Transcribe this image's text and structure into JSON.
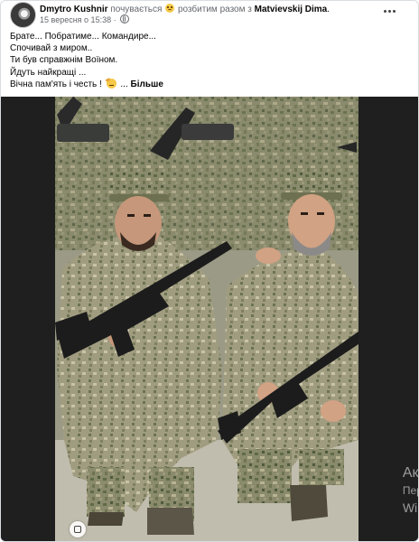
{
  "post": {
    "author": "Dmytro Kushnir",
    "feeling_text": "почувається",
    "feeling_state": "розбитим разом з",
    "tagged_friend": "Matvievskij Dima",
    "punctuation": ".",
    "timestamp": "15 вересня о 15:38",
    "separator": "·",
    "lines": [
      "Брате... Побратиме... Командире...",
      "Спочивай з миром..",
      "Ти був справжнім Воїном.",
      "Йдуть найкращі ..."
    ],
    "last_line": "Вічна пам'ять і честь !",
    "ellipsis": "...",
    "see_more": "Більше"
  },
  "icons": {
    "sad_emoji": "sad-face-icon",
    "privacy": "globe-icon",
    "salute_emoji": "salute-face-icon",
    "more": "ellipsis-icon",
    "photo_action": "gallery-icon"
  },
  "watermark": {
    "line1": "Акт",
    "line2": "Пер",
    "line3": "Win"
  },
  "colors": {
    "text": "#050505",
    "muted": "#65676b",
    "photo_border": "#1f1f1f"
  }
}
